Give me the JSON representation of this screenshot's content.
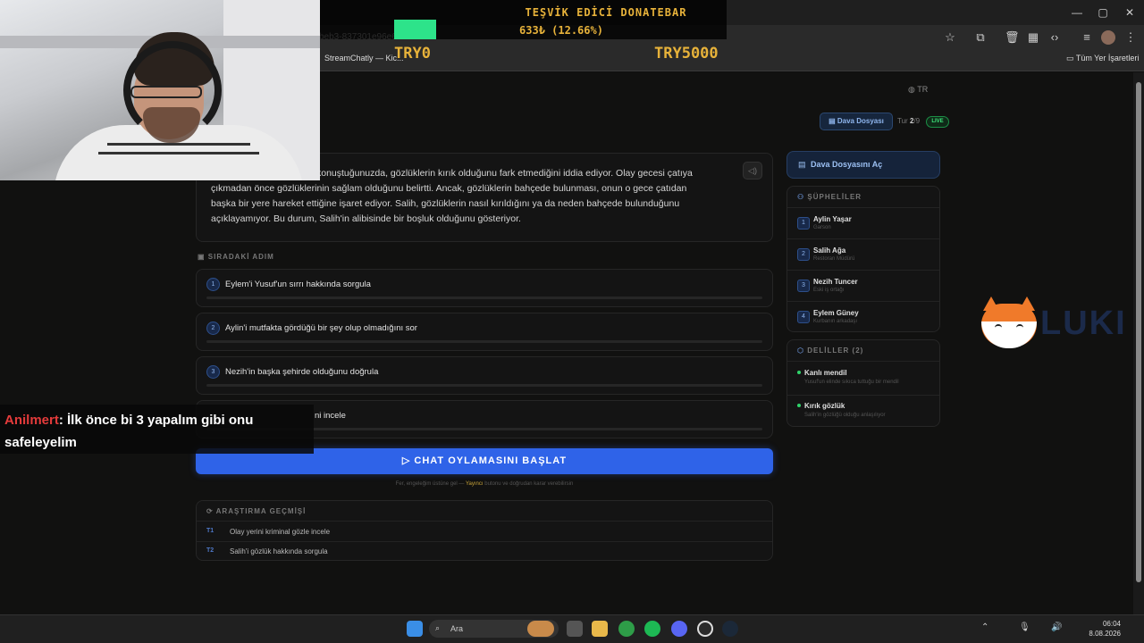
{
  "browser": {
    "url_fragment": "beb3-837301e96e64",
    "bookmark_tab": "StreamChatly — Kic...",
    "bookmarks_all": "Tüm Yer İşaretleri"
  },
  "header": {
    "lang": "TR",
    "dava_button": "Dava Dosyası",
    "tur_prefix": "Tur",
    "tur_current": "2",
    "tur_total": "/9",
    "live": "LIVE"
  },
  "narrative": {
    "line1": "konuştuğunuzda, gözlüklerin kırık olduğunu fark etmediğini iddia ediyor. Olay gecesi çatıya",
    "line2": "çıkmadan önce gözlüklerinin sağlam olduğunu belirtti. Ancak, gözlüklerin bahçede bulunması, onun o gece çatıdan",
    "line3": "başka bir yere hareket ettiğine işaret ediyor. Salih, gözlüklerin nasıl kırıldığını ya da neden bahçede bulunduğunu",
    "line4": "açıklayamıyor. Bu durum, Salih'in alibisinde bir boşluk olduğunu gösteriyor."
  },
  "next_steps": {
    "title": "SIRADAKİ ADIM",
    "items": [
      {
        "num": "1",
        "label": "Eylem'i Yusuf'un sırrı hakkında sorgula"
      },
      {
        "num": "2",
        "label": "Aylin'i mutfakta gördüğü bir şey olup olmadığını sor"
      },
      {
        "num": "3",
        "label": "Nezih'in başka şehirde olduğunu doğrula"
      },
      {
        "num": "4",
        "label": "ni incele"
      }
    ]
  },
  "chat_vote": {
    "label": "CHAT OYLAMASINI BAŞLAT",
    "hint_pre": "Fer, engeleğim üstüne gel —",
    "hint_highlight": "Yayıncı",
    "hint_post": "butonu ve doğrudan karar verebilirsin"
  },
  "history": {
    "title": "ARAŞTIRMA GEÇMİŞİ",
    "items": [
      {
        "tag": "T1",
        "label": "Olay yerini kriminal gözle incele"
      },
      {
        "tag": "T2",
        "label": "Salih'i gözlük hakkında sorgula"
      }
    ]
  },
  "sidebar": {
    "open_dava": "Dava Dosyasını Aç",
    "suspects_title": "ŞÜPHELİLER",
    "suspects": [
      {
        "num": "1",
        "name": "Aylin Yaşar",
        "role": "Garson"
      },
      {
        "num": "2",
        "name": "Salih Ağa",
        "role": "Restoran Müdürü"
      },
      {
        "num": "3",
        "name": "Nezih Tuncer",
        "role": "Eski iş ortağı"
      },
      {
        "num": "4",
        "name": "Eylem Güney",
        "role": "Kurbanın arkadaşı"
      }
    ],
    "evidence_title": "DELİLLER (2)",
    "evidence": [
      {
        "name": "Kanlı mendil",
        "desc": "Yusuf'un elinde sıkıca tuttuğu bir mendil"
      },
      {
        "name": "Kırık gözlük",
        "desc": "Salih'in gözlüğü olduğu anlaşılıyor"
      }
    ]
  },
  "overlay": {
    "donate_title": "TEŞVİK EDİCİ DONATEBAR",
    "donate_value": "633₺ (12.66%)",
    "donate_progress": 0.1266,
    "try_min": "TRY0",
    "try_max": "TRY5000",
    "chat_user": "Anilmert",
    "chat_text": ": İlk önce bi 3 yapalım gibi onu safeleyelim",
    "logo_text": "LUKI"
  },
  "taskbar": {
    "search": "Ara",
    "time": "06:04",
    "date": "8.08.2026"
  },
  "colors": {
    "accent": "#2f63e8",
    "live": "#3ee37a",
    "gold": "#e7b23a"
  }
}
